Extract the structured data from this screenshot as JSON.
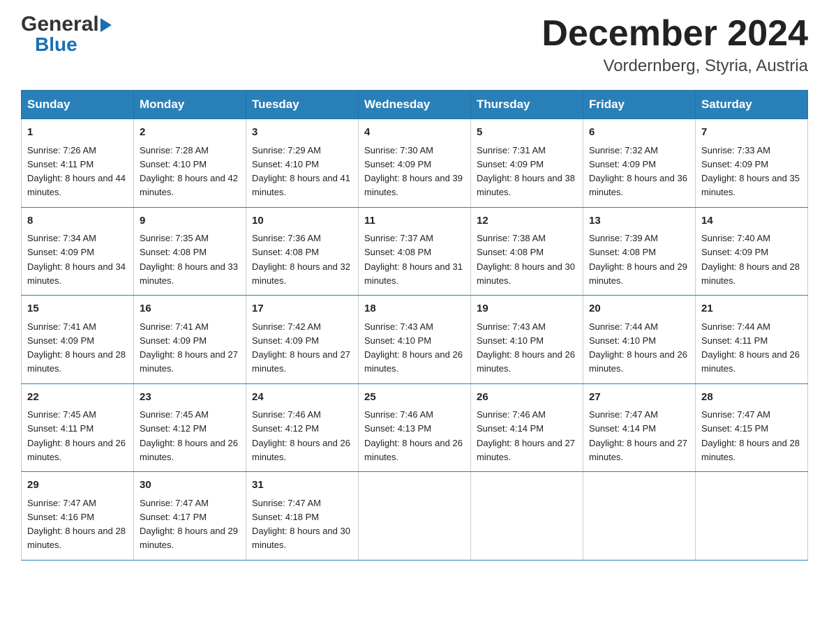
{
  "header": {
    "logo_general": "General",
    "logo_blue": "Blue",
    "month": "December 2024",
    "location": "Vordernberg, Styria, Austria"
  },
  "days_of_week": [
    "Sunday",
    "Monday",
    "Tuesday",
    "Wednesday",
    "Thursday",
    "Friday",
    "Saturday"
  ],
  "weeks": [
    [
      {
        "num": "1",
        "sunrise": "7:26 AM",
        "sunset": "4:11 PM",
        "daylight": "8 hours and 44 minutes."
      },
      {
        "num": "2",
        "sunrise": "7:28 AM",
        "sunset": "4:10 PM",
        "daylight": "8 hours and 42 minutes."
      },
      {
        "num": "3",
        "sunrise": "7:29 AM",
        "sunset": "4:10 PM",
        "daylight": "8 hours and 41 minutes."
      },
      {
        "num": "4",
        "sunrise": "7:30 AM",
        "sunset": "4:09 PM",
        "daylight": "8 hours and 39 minutes."
      },
      {
        "num": "5",
        "sunrise": "7:31 AM",
        "sunset": "4:09 PM",
        "daylight": "8 hours and 38 minutes."
      },
      {
        "num": "6",
        "sunrise": "7:32 AM",
        "sunset": "4:09 PM",
        "daylight": "8 hours and 36 minutes."
      },
      {
        "num": "7",
        "sunrise": "7:33 AM",
        "sunset": "4:09 PM",
        "daylight": "8 hours and 35 minutes."
      }
    ],
    [
      {
        "num": "8",
        "sunrise": "7:34 AM",
        "sunset": "4:09 PM",
        "daylight": "8 hours and 34 minutes."
      },
      {
        "num": "9",
        "sunrise": "7:35 AM",
        "sunset": "4:08 PM",
        "daylight": "8 hours and 33 minutes."
      },
      {
        "num": "10",
        "sunrise": "7:36 AM",
        "sunset": "4:08 PM",
        "daylight": "8 hours and 32 minutes."
      },
      {
        "num": "11",
        "sunrise": "7:37 AM",
        "sunset": "4:08 PM",
        "daylight": "8 hours and 31 minutes."
      },
      {
        "num": "12",
        "sunrise": "7:38 AM",
        "sunset": "4:08 PM",
        "daylight": "8 hours and 30 minutes."
      },
      {
        "num": "13",
        "sunrise": "7:39 AM",
        "sunset": "4:08 PM",
        "daylight": "8 hours and 29 minutes."
      },
      {
        "num": "14",
        "sunrise": "7:40 AM",
        "sunset": "4:09 PM",
        "daylight": "8 hours and 28 minutes."
      }
    ],
    [
      {
        "num": "15",
        "sunrise": "7:41 AM",
        "sunset": "4:09 PM",
        "daylight": "8 hours and 28 minutes."
      },
      {
        "num": "16",
        "sunrise": "7:41 AM",
        "sunset": "4:09 PM",
        "daylight": "8 hours and 27 minutes."
      },
      {
        "num": "17",
        "sunrise": "7:42 AM",
        "sunset": "4:09 PM",
        "daylight": "8 hours and 27 minutes."
      },
      {
        "num": "18",
        "sunrise": "7:43 AM",
        "sunset": "4:10 PM",
        "daylight": "8 hours and 26 minutes."
      },
      {
        "num": "19",
        "sunrise": "7:43 AM",
        "sunset": "4:10 PM",
        "daylight": "8 hours and 26 minutes."
      },
      {
        "num": "20",
        "sunrise": "7:44 AM",
        "sunset": "4:10 PM",
        "daylight": "8 hours and 26 minutes."
      },
      {
        "num": "21",
        "sunrise": "7:44 AM",
        "sunset": "4:11 PM",
        "daylight": "8 hours and 26 minutes."
      }
    ],
    [
      {
        "num": "22",
        "sunrise": "7:45 AM",
        "sunset": "4:11 PM",
        "daylight": "8 hours and 26 minutes."
      },
      {
        "num": "23",
        "sunrise": "7:45 AM",
        "sunset": "4:12 PM",
        "daylight": "8 hours and 26 minutes."
      },
      {
        "num": "24",
        "sunrise": "7:46 AM",
        "sunset": "4:12 PM",
        "daylight": "8 hours and 26 minutes."
      },
      {
        "num": "25",
        "sunrise": "7:46 AM",
        "sunset": "4:13 PM",
        "daylight": "8 hours and 26 minutes."
      },
      {
        "num": "26",
        "sunrise": "7:46 AM",
        "sunset": "4:14 PM",
        "daylight": "8 hours and 27 minutes."
      },
      {
        "num": "27",
        "sunrise": "7:47 AM",
        "sunset": "4:14 PM",
        "daylight": "8 hours and 27 minutes."
      },
      {
        "num": "28",
        "sunrise": "7:47 AM",
        "sunset": "4:15 PM",
        "daylight": "8 hours and 28 minutes."
      }
    ],
    [
      {
        "num": "29",
        "sunrise": "7:47 AM",
        "sunset": "4:16 PM",
        "daylight": "8 hours and 28 minutes."
      },
      {
        "num": "30",
        "sunrise": "7:47 AM",
        "sunset": "4:17 PM",
        "daylight": "8 hours and 29 minutes."
      },
      {
        "num": "31",
        "sunrise": "7:47 AM",
        "sunset": "4:18 PM",
        "daylight": "8 hours and 30 minutes."
      },
      null,
      null,
      null,
      null
    ]
  ]
}
